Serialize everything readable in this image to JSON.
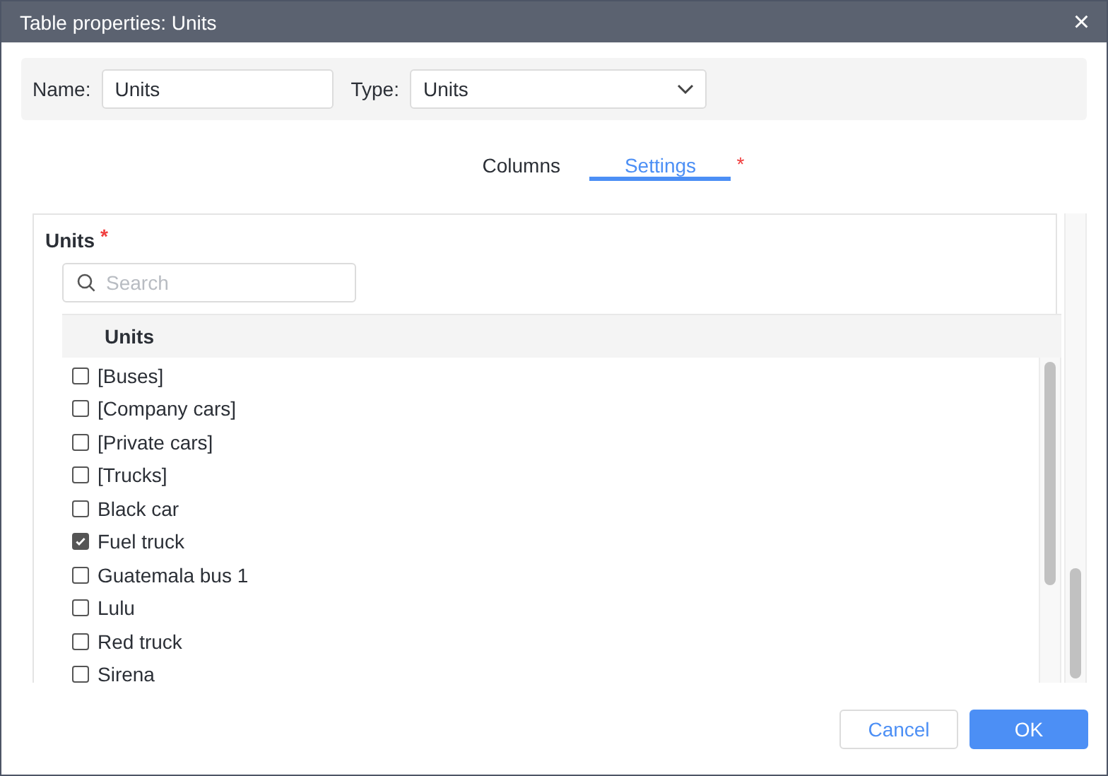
{
  "window": {
    "title": "Table properties: Units",
    "close": "×"
  },
  "form": {
    "name_label": "Name:",
    "name_value": "Units",
    "type_label": "Type:",
    "type_value": "Units"
  },
  "tabs": [
    {
      "label": "Columns",
      "selected": false,
      "required": false
    },
    {
      "label": "Settings",
      "selected": true,
      "required": true
    }
  ],
  "required_mark": "*",
  "units": {
    "label": "Units",
    "required": true,
    "search": {
      "placeholder": "Search"
    },
    "column": "Units",
    "rows": [
      {
        "name": "[Buses]",
        "checked": false
      },
      {
        "name": "[Company cars]",
        "checked": false
      },
      {
        "name": "[Private cars]",
        "checked": false
      },
      {
        "name": "[Trucks]",
        "checked": false
      },
      {
        "name": "Black car",
        "checked": false
      },
      {
        "name": "Fuel truck",
        "checked": true
      },
      {
        "name": "Guatemala bus 1",
        "checked": false
      },
      {
        "name": "Lulu",
        "checked": false
      },
      {
        "name": "Red truck",
        "checked": false
      },
      {
        "name": "Sirena",
        "checked": false
      }
    ]
  },
  "buttons": [
    {
      "label": "Cancel",
      "kind": "secondary"
    },
    {
      "label": "OK",
      "kind": "primary"
    }
  ]
}
